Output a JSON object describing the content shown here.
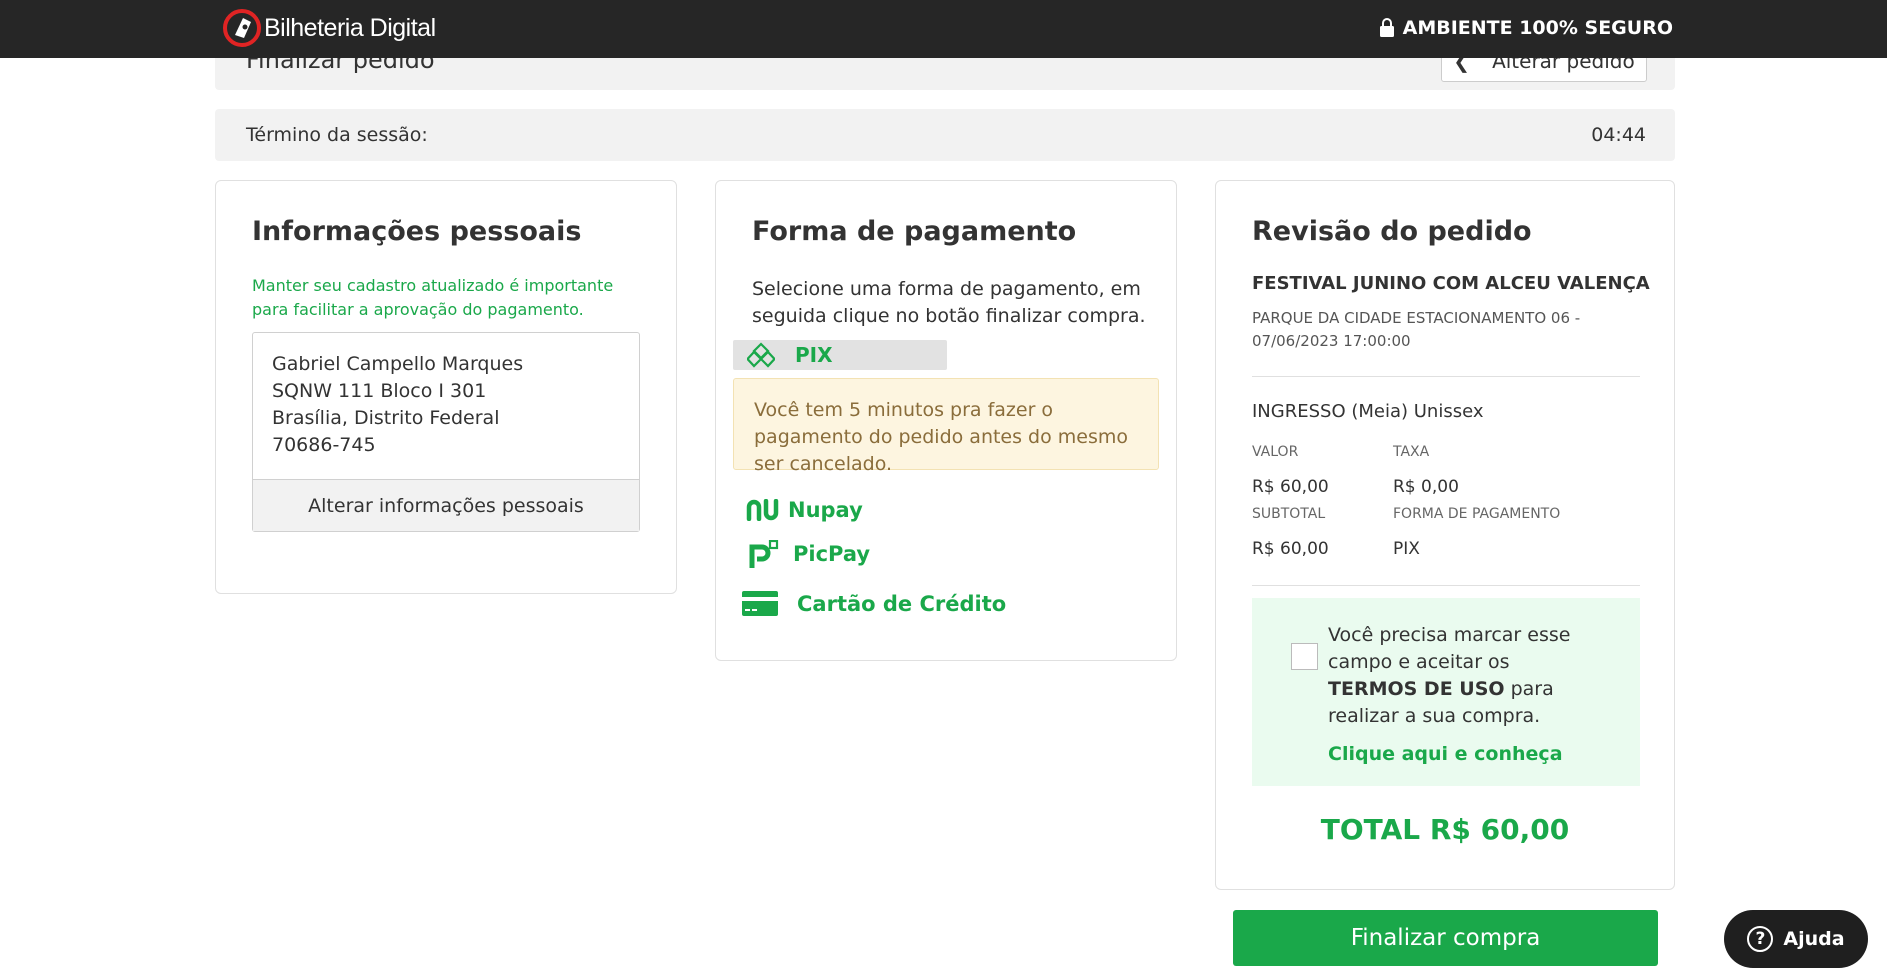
{
  "header": {
    "brand": "Bilheteria Digital",
    "secure_label": "AMBIENTE 100% SEGURO"
  },
  "page": {
    "title": "Finalizar pedido",
    "alter_order_label": "Alterar pedido",
    "session_label": "Término da sessão:",
    "session_time": "04:44"
  },
  "personal": {
    "title": "Informações pessoais",
    "hint": "Manter seu cadastro atualizado é importante para facilitar a aprovação do pagamento.",
    "address_lines": [
      "Gabriel Campello Marques",
      "SQNW 111 Bloco I 301",
      "Brasília, Distrito Federal",
      "70686-745"
    ],
    "alter_label": "Alterar informações pessoais"
  },
  "payment": {
    "title": "Forma de pagamento",
    "description": "Selecione uma forma de pagamento, em seguida clique no botão finalizar compra.",
    "selected": "PIX",
    "pix_notice": "Você tem 5 minutos pra fazer o pagamento do pedido antes do mesmo ser cancelado.",
    "options": [
      "Nupay",
      "PicPay",
      "Cartão de Crédito"
    ],
    "accent_color": "#1aa84a"
  },
  "review": {
    "title": "Revisão do pedido",
    "event_name": "FESTIVAL JUNINO COM ALCEU VALENÇA",
    "event_venue": "PARQUE DA CIDADE ESTACIONAMENTO 06 - 07/06/2023 17:00:00",
    "ticket_name": "INGRESSO (Meia) Unissex",
    "valor_label": "VALOR",
    "valor": "R$ 60,00",
    "taxa_label": "TAXA",
    "taxa": "R$ 0,00",
    "subtotal_label": "SUBTOTAL",
    "subtotal": "R$ 60,00",
    "forma_label": "FORMA DE PAGAMENTO",
    "forma": "PIX",
    "terms_pre": "Você precisa marcar esse campo e aceitar os ",
    "terms_bold": "TERMOS DE USO",
    "terms_post": " para realizar a sua compra.",
    "terms_link": "Clique aqui e conheça",
    "total": "TOTAL R$ 60,00"
  },
  "actions": {
    "finalize_label": "Finalizar compra",
    "help_label": "Ajuda"
  }
}
